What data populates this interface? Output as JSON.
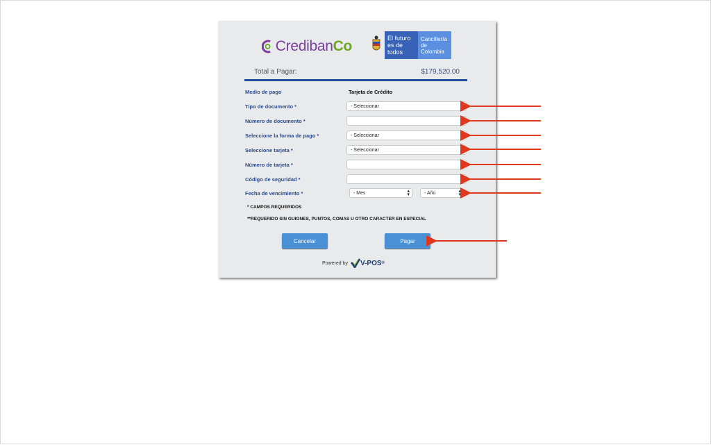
{
  "brand": {
    "credibanco_pre": "Crediban",
    "credibanco_post": "Co",
    "gov_line1": "El futuro es de todos",
    "gov_line2": "Cancillería de Colombia"
  },
  "total": {
    "label": "Total a Pagar:",
    "amount": "$179,520.00"
  },
  "form": {
    "payment_method_label": "Medio de pago",
    "payment_method_value": "Tarjeta de Crédito",
    "doc_type_label": "Tipo de documento *",
    "doc_type_value": "- Seleccionar",
    "doc_number_label": "Número de documento *",
    "payment_form_label": "Seleccione la forma de pago *",
    "payment_form_value": "- Seleccionar",
    "card_select_label": "Seleccione tarjeta *",
    "card_select_value": "- Seleccionar",
    "card_number_label": "Número de tarjeta *",
    "security_code_label": "Código de seguridad *",
    "expiry_label": "Fecha de vencimiento *",
    "expiry_month_value": "- Mes",
    "expiry_year_value": "- Año"
  },
  "notes": {
    "required": "* CAMPOS REQUERIDOS",
    "no_special": "**REQUERIDO SIN GUIONES, PUNTOS, COMAS U OTRO CARACTER EN ESPECIAL"
  },
  "buttons": {
    "cancel": "Cancelar",
    "pay": "Pagar"
  },
  "footer": {
    "powered_by": "Powered by",
    "vpos": "V-POS",
    "reg": "®"
  },
  "colors": {
    "arrow": "#e0381f",
    "button": "#4a90d4",
    "label": "#2c4a8a"
  }
}
